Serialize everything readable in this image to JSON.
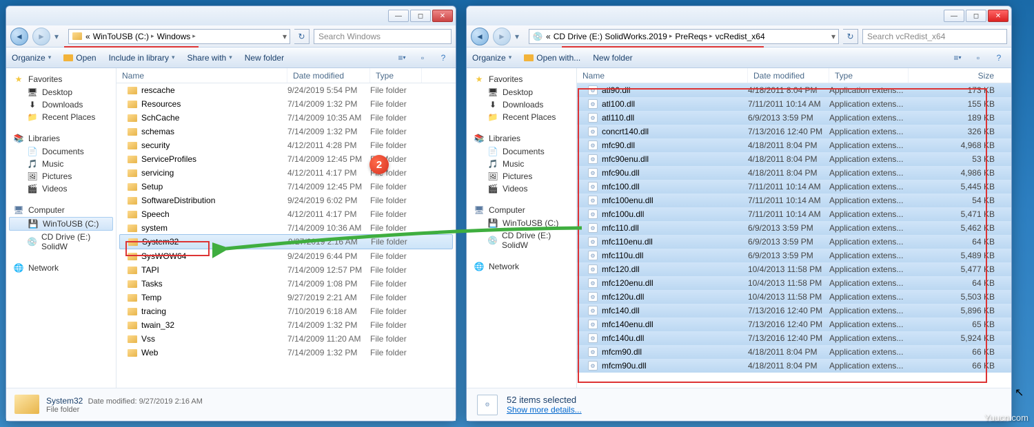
{
  "left": {
    "breadcrumb": [
      {
        "label": "«",
        "sep": ""
      },
      {
        "label": "WinToUSB (C:)",
        "sep": "▸"
      },
      {
        "label": "Windows",
        "sep": "▸"
      }
    ],
    "search_placeholder": "Search Windows",
    "toolbar": {
      "organize": "Organize",
      "open": "Open",
      "include": "Include in library",
      "share": "Share with",
      "newfolder": "New folder"
    },
    "nav": {
      "favorites": "Favorites",
      "desktop": "Desktop",
      "downloads": "Downloads",
      "recent": "Recent Places",
      "libraries": "Libraries",
      "documents": "Documents",
      "music": "Music",
      "pictures": "Pictures",
      "videos": "Videos",
      "computer": "Computer",
      "drive_c": "WinToUSB (C:)",
      "drive_e": "CD Drive (E:) SolidW",
      "network": "Network"
    },
    "cols": {
      "name": "Name",
      "date": "Date modified",
      "type": "Type"
    },
    "rows": [
      {
        "name": "rescache",
        "date": "9/24/2019 5:54 PM",
        "type": "File folder"
      },
      {
        "name": "Resources",
        "date": "7/14/2009 1:32 PM",
        "type": "File folder"
      },
      {
        "name": "SchCache",
        "date": "7/14/2009 10:35 AM",
        "type": "File folder"
      },
      {
        "name": "schemas",
        "date": "7/14/2009 1:32 PM",
        "type": "File folder"
      },
      {
        "name": "security",
        "date": "4/12/2011 4:28 PM",
        "type": "File folder"
      },
      {
        "name": "ServiceProfiles",
        "date": "7/14/2009 12:45 PM",
        "type": "File folder"
      },
      {
        "name": "servicing",
        "date": "4/12/2011 4:17 PM",
        "type": "File folder"
      },
      {
        "name": "Setup",
        "date": "7/14/2009 12:45 PM",
        "type": "File folder"
      },
      {
        "name": "SoftwareDistribution",
        "date": "9/24/2019 6:02 PM",
        "type": "File folder"
      },
      {
        "name": "Speech",
        "date": "4/12/2011 4:17 PM",
        "type": "File folder"
      },
      {
        "name": "system",
        "date": "7/14/2009 10:36 AM",
        "type": "File folder"
      },
      {
        "name": "System32",
        "date": "9/27/2019 2:16 AM",
        "type": "File folder",
        "selected": true
      },
      {
        "name": "SysWOW64",
        "date": "9/24/2019 6:44 PM",
        "type": "File folder"
      },
      {
        "name": "TAPI",
        "date": "7/14/2009 12:57 PM",
        "type": "File folder"
      },
      {
        "name": "Tasks",
        "date": "7/14/2009 1:08 PM",
        "type": "File folder"
      },
      {
        "name": "Temp",
        "date": "9/27/2019 2:21 AM",
        "type": "File folder"
      },
      {
        "name": "tracing",
        "date": "7/10/2019 6:18 AM",
        "type": "File folder"
      },
      {
        "name": "twain_32",
        "date": "7/14/2009 1:32 PM",
        "type": "File folder"
      },
      {
        "name": "Vss",
        "date": "7/14/2009 11:20 AM",
        "type": "File folder"
      },
      {
        "name": "Web",
        "date": "7/14/2009 1:32 PM",
        "type": "File folder"
      }
    ],
    "details": {
      "name": "System32",
      "meta": "Date modified: 9/27/2019 2:16 AM",
      "sub": "File folder"
    }
  },
  "right": {
    "breadcrumb": [
      {
        "label": "«",
        "sep": ""
      },
      {
        "label": "CD Drive (E:) SolidWorks.2019",
        "sep": "▸"
      },
      {
        "label": "PreReqs",
        "sep": "▸"
      },
      {
        "label": "vcRedist_x64",
        "sep": "▸"
      }
    ],
    "search_placeholder": "Search vcRedist_x64",
    "toolbar": {
      "organize": "Organize",
      "openwith": "Open with...",
      "newfolder": "New folder"
    },
    "nav": {
      "favorites": "Favorites",
      "desktop": "Desktop",
      "downloads": "Downloads",
      "recent": "Recent Places",
      "libraries": "Libraries",
      "documents": "Documents",
      "music": "Music",
      "pictures": "Pictures",
      "videos": "Videos",
      "computer": "Computer",
      "drive_c": "WinToUSB (C:)",
      "drive_e": "CD Drive (E:) SolidW",
      "network": "Network"
    },
    "cols": {
      "name": "Name",
      "date": "Date modified",
      "type": "Type",
      "size": "Size"
    },
    "rows": [
      {
        "name": "atl90.dll",
        "date": "4/18/2011 8:04 PM",
        "type": "Application extens...",
        "size": "173 KB"
      },
      {
        "name": "atl100.dll",
        "date": "7/11/2011 10:14 AM",
        "type": "Application extens...",
        "size": "155 KB"
      },
      {
        "name": "atl110.dll",
        "date": "6/9/2013 3:59 PM",
        "type": "Application extens...",
        "size": "189 KB"
      },
      {
        "name": "concrt140.dll",
        "date": "7/13/2016 12:40 PM",
        "type": "Application extens...",
        "size": "326 KB"
      },
      {
        "name": "mfc90.dll",
        "date": "4/18/2011 8:04 PM",
        "type": "Application extens...",
        "size": "4,968 KB"
      },
      {
        "name": "mfc90enu.dll",
        "date": "4/18/2011 8:04 PM",
        "type": "Application extens...",
        "size": "53 KB"
      },
      {
        "name": "mfc90u.dll",
        "date": "4/18/2011 8:04 PM",
        "type": "Application extens...",
        "size": "4,986 KB"
      },
      {
        "name": "mfc100.dll",
        "date": "7/11/2011 10:14 AM",
        "type": "Application extens...",
        "size": "5,445 KB"
      },
      {
        "name": "mfc100enu.dll",
        "date": "7/11/2011 10:14 AM",
        "type": "Application extens...",
        "size": "54 KB"
      },
      {
        "name": "mfc100u.dll",
        "date": "7/11/2011 10:14 AM",
        "type": "Application extens...",
        "size": "5,471 KB"
      },
      {
        "name": "mfc110.dll",
        "date": "6/9/2013 3:59 PM",
        "type": "Application extens...",
        "size": "5,462 KB"
      },
      {
        "name": "mfc110enu.dll",
        "date": "6/9/2013 3:59 PM",
        "type": "Application extens...",
        "size": "64 KB"
      },
      {
        "name": "mfc110u.dll",
        "date": "6/9/2013 3:59 PM",
        "type": "Application extens...",
        "size": "5,489 KB"
      },
      {
        "name": "mfc120.dll",
        "date": "10/4/2013 11:58 PM",
        "type": "Application extens...",
        "size": "5,477 KB"
      },
      {
        "name": "mfc120enu.dll",
        "date": "10/4/2013 11:58 PM",
        "type": "Application extens...",
        "size": "64 KB"
      },
      {
        "name": "mfc120u.dll",
        "date": "10/4/2013 11:58 PM",
        "type": "Application extens...",
        "size": "5,503 KB"
      },
      {
        "name": "mfc140.dll",
        "date": "7/13/2016 12:40 PM",
        "type": "Application extens...",
        "size": "5,896 KB"
      },
      {
        "name": "mfc140enu.dll",
        "date": "7/13/2016 12:40 PM",
        "type": "Application extens...",
        "size": "65 KB"
      },
      {
        "name": "mfc140u.dll",
        "date": "7/13/2016 12:40 PM",
        "type": "Application extens...",
        "size": "5,924 KB"
      },
      {
        "name": "mfcm90.dll",
        "date": "4/18/2011 8:04 PM",
        "type": "Application extens...",
        "size": "66 KB"
      },
      {
        "name": "mfcm90u.dll",
        "date": "4/18/2011 8:04 PM",
        "type": "Application extens...",
        "size": "66 KB"
      }
    ],
    "details": {
      "count": "52 items selected",
      "more": "Show more details..."
    }
  },
  "badge": "2",
  "watermark": "Yuucn.com"
}
